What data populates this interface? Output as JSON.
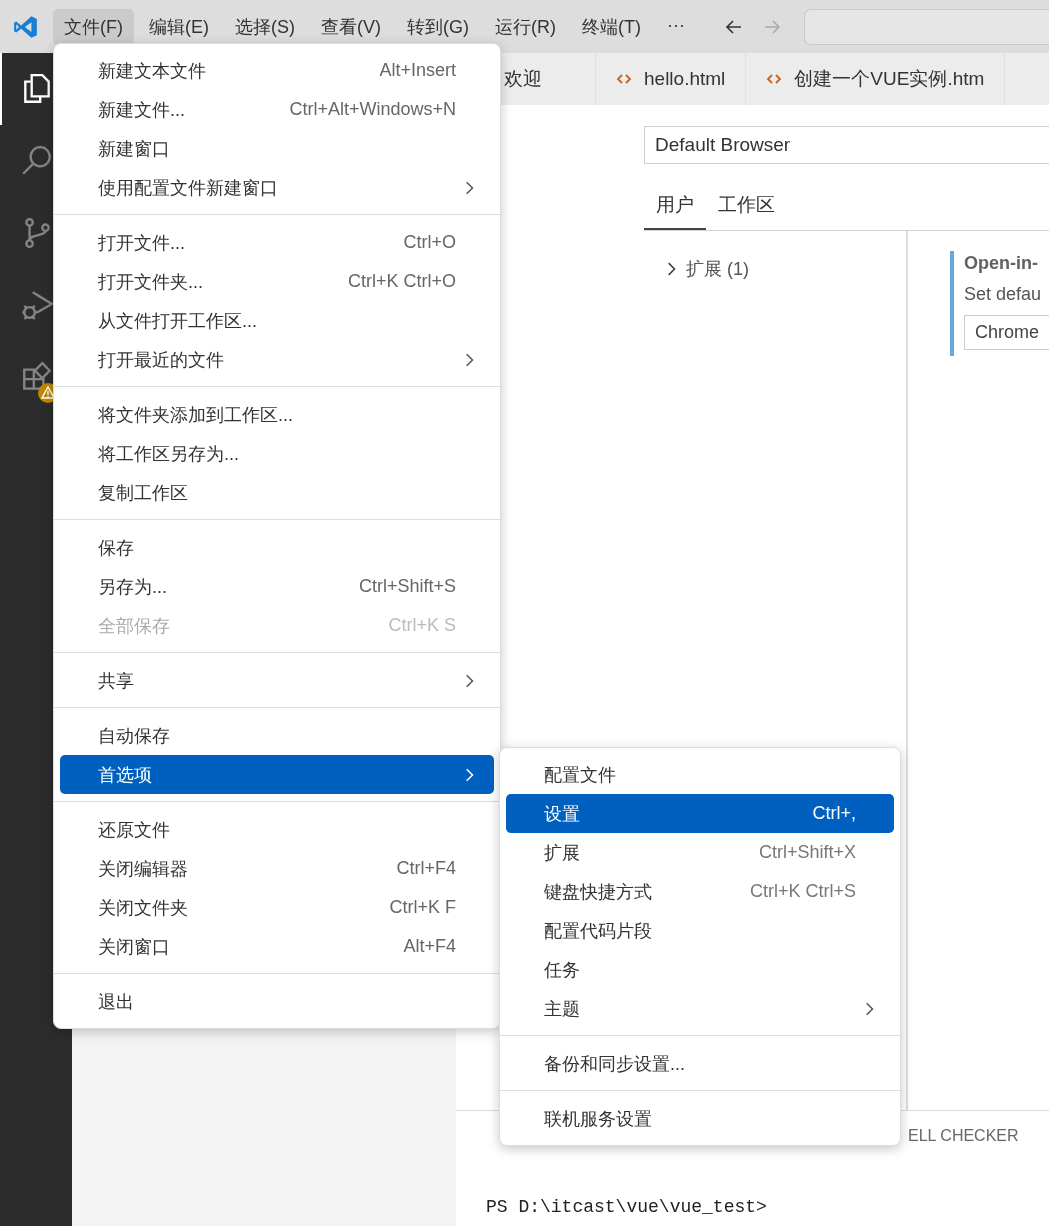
{
  "menubar": {
    "items": [
      {
        "label": "文件(F)",
        "selected": true
      },
      {
        "label": "编辑(E)",
        "selected": false
      },
      {
        "label": "选择(S)",
        "selected": false
      },
      {
        "label": "查看(V)",
        "selected": false
      },
      {
        "label": "转到(G)",
        "selected": false
      },
      {
        "label": "运行(R)",
        "selected": false
      },
      {
        "label": "终端(T)",
        "selected": false
      }
    ],
    "more": "···"
  },
  "activity_bar": [
    {
      "kind": "files",
      "selected": true
    },
    {
      "kind": "search",
      "selected": false
    },
    {
      "kind": "branch",
      "selected": false
    },
    {
      "kind": "debug",
      "selected": false
    },
    {
      "kind": "extensions",
      "selected": false,
      "warning": true
    }
  ],
  "editor_tabs": [
    {
      "label": "欢迎",
      "kind": "text"
    },
    {
      "label": "hello.html",
      "kind": "html"
    },
    {
      "label": "创建一个VUE实例.htm",
      "kind": "html"
    }
  ],
  "settings": {
    "search": {
      "value": "Default Browser"
    },
    "scope_tabs": [
      {
        "label": "用户",
        "selected": true
      },
      {
        "label": "工作区",
        "selected": false
      }
    ],
    "tree": [
      {
        "label": "扩展 (1)",
        "expanded": false
      }
    ],
    "setting": {
      "title": "Open-in-",
      "description": "Set defau",
      "value": "Chrome"
    }
  },
  "panel": {
    "tabs": [
      {
        "label": "ELL CHECKER"
      }
    ],
    "terminal": "PS D:\\itcast\\vue\\vue_test>"
  },
  "file_menu": {
    "groups": [
      [
        {
          "label": "新建文本文件",
          "shortcut": "Alt+Insert",
          "submenu": false,
          "disabled": false,
          "highlighted": false
        },
        {
          "label": "新建文件...",
          "shortcut": "Ctrl+Alt+Windows+N",
          "submenu": false,
          "disabled": false,
          "highlighted": false
        },
        {
          "label": "新建窗口",
          "submenu": false,
          "disabled": false,
          "highlighted": false
        },
        {
          "label": "使用配置文件新建窗口",
          "submenu": true,
          "disabled": false,
          "highlighted": false
        }
      ],
      [
        {
          "label": "打开文件...",
          "shortcut": "Ctrl+O",
          "submenu": false,
          "disabled": false,
          "highlighted": false
        },
        {
          "label": "打开文件夹...",
          "shortcut": "Ctrl+K Ctrl+O",
          "submenu": false,
          "disabled": false,
          "highlighted": false
        },
        {
          "label": "从文件打开工作区...",
          "submenu": false,
          "disabled": false,
          "highlighted": false
        },
        {
          "label": "打开最近的文件",
          "submenu": true,
          "disabled": false,
          "highlighted": false
        }
      ],
      [
        {
          "label": "将文件夹添加到工作区...",
          "submenu": false,
          "disabled": false,
          "highlighted": false
        },
        {
          "label": "将工作区另存为...",
          "submenu": false,
          "disabled": false,
          "highlighted": false
        },
        {
          "label": "复制工作区",
          "submenu": false,
          "disabled": false,
          "highlighted": false
        }
      ],
      [
        {
          "label": "保存",
          "submenu": false,
          "disabled": false,
          "highlighted": false
        },
        {
          "label": "另存为...",
          "shortcut": "Ctrl+Shift+S",
          "submenu": false,
          "disabled": false,
          "highlighted": false
        },
        {
          "label": "全部保存",
          "shortcut": "Ctrl+K S",
          "submenu": false,
          "disabled": true,
          "highlighted": false
        }
      ],
      [
        {
          "label": "共享",
          "submenu": true,
          "disabled": false,
          "highlighted": false
        }
      ],
      [
        {
          "label": "自动保存",
          "submenu": false,
          "disabled": false,
          "highlighted": false
        },
        {
          "label": "首选项",
          "submenu": true,
          "disabled": false,
          "highlighted": true
        }
      ],
      [
        {
          "label": "还原文件",
          "submenu": false,
          "disabled": false,
          "highlighted": false
        },
        {
          "label": "关闭编辑器",
          "shortcut": "Ctrl+F4",
          "submenu": false,
          "disabled": false,
          "highlighted": false
        },
        {
          "label": "关闭文件夹",
          "shortcut": "Ctrl+K F",
          "submenu": false,
          "disabled": false,
          "highlighted": false
        },
        {
          "label": "关闭窗口",
          "shortcut": "Alt+F4",
          "submenu": false,
          "disabled": false,
          "highlighted": false
        }
      ],
      [
        {
          "label": "退出",
          "submenu": false,
          "disabled": false,
          "highlighted": false
        }
      ]
    ]
  },
  "preferences_menu": {
    "groups": [
      [
        {
          "label": "配置文件",
          "submenu": false,
          "disabled": false,
          "highlighted": false
        },
        {
          "label": "设置",
          "shortcut": "Ctrl+,",
          "submenu": false,
          "disabled": false,
          "highlighted": true
        },
        {
          "label": "扩展",
          "shortcut": "Ctrl+Shift+X",
          "submenu": false,
          "disabled": false,
          "highlighted": false
        },
        {
          "label": "键盘快捷方式",
          "shortcut": "Ctrl+K Ctrl+S",
          "submenu": false,
          "disabled": false,
          "highlighted": false
        },
        {
          "label": "配置代码片段",
          "submenu": false,
          "disabled": false,
          "highlighted": false
        },
        {
          "label": "任务",
          "submenu": false,
          "disabled": false,
          "highlighted": false
        },
        {
          "label": "主题",
          "submenu": true,
          "disabled": false,
          "highlighted": false
        }
      ],
      [
        {
          "label": "备份和同步设置...",
          "submenu": false,
          "disabled": false,
          "highlighted": false
        }
      ],
      [
        {
          "label": "联机服务设置",
          "submenu": false,
          "disabled": false,
          "highlighted": false
        }
      ]
    ]
  }
}
